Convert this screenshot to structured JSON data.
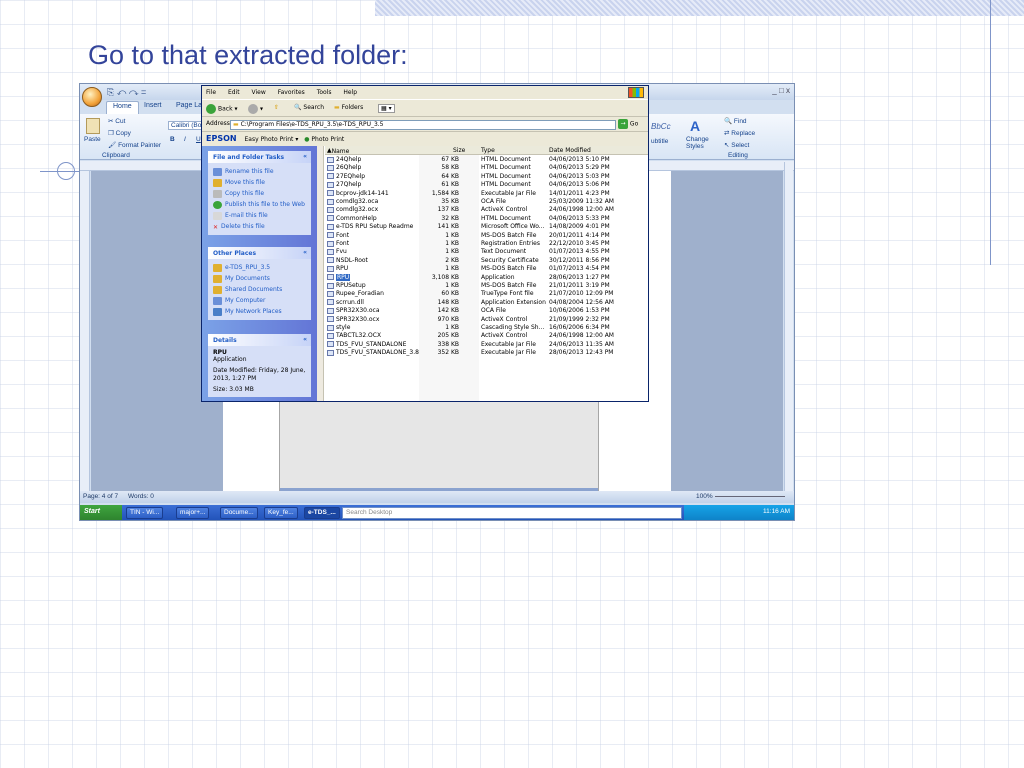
{
  "slide": {
    "title": "Go to that extracted folder:"
  },
  "word": {
    "qat": "⎘ ↶ ↷ =",
    "window_controls": "_ □ x",
    "tabs": [
      "Home",
      "Insert",
      "Page Lay"
    ],
    "ribbon": {
      "cut": "Cut",
      "copy": "Copy",
      "paste": "Paste",
      "format_painter": "Format Painter",
      "clipboard": "Clipboard",
      "font": "Calibri (Boc",
      "bold": "B",
      "italic": "I",
      "underline": "U",
      "style_preview": "BbCc",
      "subtitle": "ubtitle",
      "change_styles": "Change Styles",
      "find": "Find",
      "replace": "Replace",
      "select": "Select",
      "editing": "Editing"
    },
    "status": {
      "page": "Page: 4 of 7",
      "words": "Words: 0",
      "zoom": "100%"
    },
    "taskbar": {
      "start": "Start",
      "items": [
        "TIN - Wi...",
        "major+...",
        "Docume...",
        "Key_fe...",
        "e-TDS_..."
      ],
      "search": "Search Desktop",
      "time": "11:16 AM"
    }
  },
  "explorer": {
    "menu": [
      "File",
      "Edit",
      "View",
      "Favorites",
      "Tools",
      "Help"
    ],
    "toolbar": {
      "back": "Back",
      "search": "Search",
      "folders": "Folders"
    },
    "address": {
      "label": "Address",
      "path": "C:\\Program Files\\e-TDS_RPU_3.5\\e-TDS_RPU_3.5",
      "go": "Go"
    },
    "epson": {
      "brand": "EPSON",
      "easy_print": "Easy Photo Print",
      "photo_print": "Photo Print"
    },
    "file_tasks": {
      "title": "File and Folder Tasks",
      "items": [
        "Rename this file",
        "Move this file",
        "Copy this file",
        "Publish this file to the Web",
        "E-mail this file",
        "Delete this file"
      ]
    },
    "other_places": {
      "title": "Other Places",
      "items": [
        "e-TDS_RPU_3.5",
        "My Documents",
        "Shared Documents",
        "My Computer",
        "My Network Places"
      ]
    },
    "details": {
      "title": "Details",
      "name": "RPU",
      "type": "Application",
      "modified": "Date Modified: Friday, 28 June, 2013, 1:27 PM",
      "size": "Size: 3.03 MB"
    },
    "columns": {
      "name": "Name",
      "size": "Size",
      "type": "Type",
      "date": "Date Modified"
    },
    "files": [
      {
        "name": "24Qhelp",
        "size": "67 KB",
        "type": "HTML Document",
        "date": "04/06/2013 5:10 PM"
      },
      {
        "name": "26Qhelp",
        "size": "58 KB",
        "type": "HTML Document",
        "date": "04/06/2013 5:29 PM"
      },
      {
        "name": "27EQhelp",
        "size": "64 KB",
        "type": "HTML Document",
        "date": "04/06/2013 5:03 PM"
      },
      {
        "name": "27Qhelp",
        "size": "61 KB",
        "type": "HTML Document",
        "date": "04/06/2013 5:06 PM"
      },
      {
        "name": "bcprov-jdk14-141",
        "size": "1,584 KB",
        "type": "Executable Jar File",
        "date": "14/01/2011 4:23 PM"
      },
      {
        "name": "comdlg32.oca",
        "size": "35 KB",
        "type": "OCA File",
        "date": "25/03/2009 11:32 AM"
      },
      {
        "name": "comdlg32.ocx",
        "size": "137 KB",
        "type": "ActiveX Control",
        "date": "24/06/1998 12:00 AM"
      },
      {
        "name": "CommonHelp",
        "size": "32 KB",
        "type": "HTML Document",
        "date": "04/06/2013 5:33 PM"
      },
      {
        "name": "e-TDS RPU Setup Readme",
        "size": "141 KB",
        "type": "Microsoft Office Wo...",
        "date": "14/08/2009 4:01 PM"
      },
      {
        "name": "Font",
        "size": "1 KB",
        "type": "MS-DOS Batch File",
        "date": "20/01/2011 4:14 PM"
      },
      {
        "name": "Font",
        "size": "1 KB",
        "type": "Registration Entries",
        "date": "22/12/2010 3:45 PM"
      },
      {
        "name": "Fvu",
        "size": "1 KB",
        "type": "Text Document",
        "date": "01/07/2013 4:55 PM"
      },
      {
        "name": "NSDL-Root",
        "size": "2 KB",
        "type": "Security Certificate",
        "date": "30/12/2011 8:56 PM"
      },
      {
        "name": "RPU",
        "size": "1 KB",
        "type": "MS-DOS Batch File",
        "date": "01/07/2013 4:54 PM"
      },
      {
        "name": "RPU",
        "size": "3,108 KB",
        "type": "Application",
        "date": "28/06/2013 1:27 PM"
      },
      {
        "name": "RPUSetup",
        "size": "1 KB",
        "type": "MS-DOS Batch File",
        "date": "21/01/2011 3:19 PM"
      },
      {
        "name": "Rupee_Foradian",
        "size": "60 KB",
        "type": "TrueType Font file",
        "date": "21/07/2010 12:09 PM"
      },
      {
        "name": "scrrun.dll",
        "size": "148 KB",
        "type": "Application Extension",
        "date": "04/08/2004 12:56 AM"
      },
      {
        "name": "SPR32X30.oca",
        "size": "142 KB",
        "type": "OCA File",
        "date": "10/06/2006 1:53 PM"
      },
      {
        "name": "SPR32X30.ocx",
        "size": "970 KB",
        "type": "ActiveX Control",
        "date": "21/09/1999 2:32 PM"
      },
      {
        "name": "style",
        "size": "1 KB",
        "type": "Cascading Style Sh...",
        "date": "16/06/2006 6:34 PM"
      },
      {
        "name": "TABCTL32.OCX",
        "size": "205 KB",
        "type": "ActiveX Control",
        "date": "24/06/1998 12:00 AM"
      },
      {
        "name": "TDS_FVU_STANDALONE",
        "size": "338 KB",
        "type": "Executable Jar File",
        "date": "24/06/2013 11:35 AM"
      },
      {
        "name": "TDS_FVU_STANDALONE_3.8",
        "size": "352 KB",
        "type": "Executable Jar File",
        "date": "28/06/2013 12:43 PM"
      }
    ],
    "selected_index": 14
  }
}
